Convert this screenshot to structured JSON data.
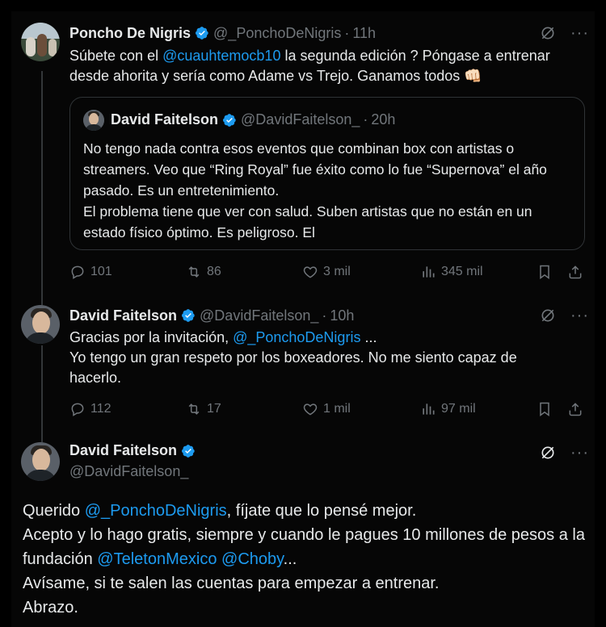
{
  "tweets": [
    {
      "name": "Poncho De Nigris",
      "handle": "@_PonchoDeNigris",
      "time": "11h",
      "text_parts": [
        "Súbete con el ",
        "@cuauhtemocb10",
        "  la segunda edición ? Póngase a entrenar desde ahorita y sería como Adame vs Trejo. Ganamos todos 👊🏻"
      ],
      "quote": {
        "name": "David Faitelson",
        "handle": "@DavidFaitelson_",
        "time": "20h",
        "text_line1": "No tengo nada contra esos eventos que combinan box con artistas o streamers. Veo que “Ring Royal” fue éxito como lo fue “Supernova” el año pasado. Es un entretenimiento.",
        "text_line2": "El problema tiene que ver con salud. Suben artistas que no están en un estado físico óptimo. Es peligroso. El"
      },
      "stats": {
        "replies": "101",
        "reposts": "86",
        "likes": "3 mil",
        "views": "345 mil"
      }
    },
    {
      "name": "David Faitelson",
      "handle": "@DavidFaitelson_",
      "time": "10h",
      "text_a": "Gracias por la invitación, ",
      "text_mention": "@_PonchoDeNigris",
      "text_b": " ...",
      "text_line2": "Yo tengo un gran respeto por los boxeadores. No me siento capaz de hacerlo.",
      "stats": {
        "replies": "112",
        "reposts": "17",
        "likes": "1 mil",
        "views": "97 mil"
      }
    },
    {
      "name": "David Faitelson",
      "handle": "@DavidFaitelson_",
      "line1_a": "Querido ",
      "line1_mention": "@_PonchoDeNigris",
      "line1_b": ", fíjate que lo pensé mejor.",
      "line2": "Acepto y lo hago gratis, siempre y cuando le pagues 10 millones de pesos a la fundación ",
      "line2_mention1": "@TeletonMexico",
      "line2_mention2": "@Choby",
      "line2_end": "...",
      "line3": "Avísame, si te salen las cuentas para empezar a entrenar.",
      "line4": "Abrazo."
    }
  ],
  "dot": "·",
  "more": "···",
  "colors": {
    "accent": "#1d9bf0",
    "muted": "#71767b",
    "text": "#e7e9ea",
    "bg": "#000000"
  },
  "icons": [
    "verified-badge-icon",
    "grok-icon",
    "more-icon",
    "reply-icon",
    "repost-icon",
    "like-icon",
    "views-icon",
    "bookmark-icon",
    "share-icon"
  ]
}
